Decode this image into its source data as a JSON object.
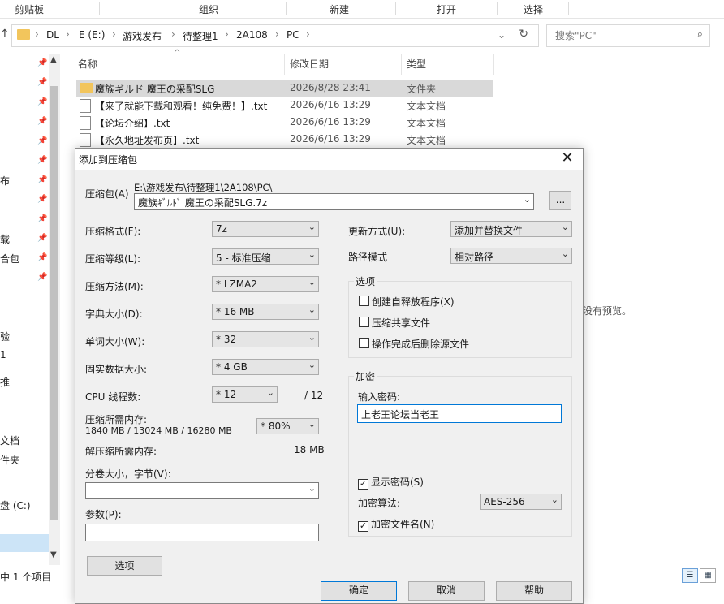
{
  "ribbon": {
    "groups": [
      "剪贴板",
      "组织",
      "新建",
      "打开",
      "选择"
    ]
  },
  "address_bar": {
    "crumbs": [
      "DL",
      "E (E:)",
      "游戏发布",
      "待整理1",
      "2A108",
      "PC"
    ]
  },
  "search": {
    "placeholder": "搜索\"PC\""
  },
  "left_pane": {
    "partial_labels": [
      "布",
      "载",
      "合包",
      "验",
      "1",
      "推",
      "文档",
      "件夹",
      "盘 (C:)"
    ]
  },
  "file_list": {
    "headers": {
      "name": "名称",
      "date": "修改日期",
      "type": "类型"
    },
    "rows": [
      {
        "name": "魔族ギルド 魔王の采配SLG",
        "date": "2026/8/28 23:41",
        "type": "文件夹",
        "icon": "folder-icon"
      },
      {
        "name": "【来了就能下载和观看！纯免费！】.txt",
        "date": "2026/6/16 13:29",
        "type": "文本文档",
        "icon": "text-file-icon"
      },
      {
        "name": "【论坛介绍】.txt",
        "date": "2026/6/16 13:29",
        "type": "文本文档",
        "icon": "text-file-icon"
      },
      {
        "name": "【永久地址发布页】.txt",
        "date": "2026/6/16 13:29",
        "type": "文本文档",
        "icon": "text-file-icon"
      }
    ]
  },
  "preview": {
    "text": "没有预览。"
  },
  "status": {
    "text": "中 1 个项目"
  },
  "dialog": {
    "title": "添加到压缩包",
    "archive_label": "压缩包(A)",
    "archive_path": "E:\\游戏发布\\待整理1\\2A108\\PC\\",
    "archive_name": "魔族ｷﾞﾙﾄﾞ 魔王の采配SLG.7z",
    "browse_label": "...",
    "format": {
      "label": "压缩格式(F):",
      "value": "7z"
    },
    "level": {
      "label": "压缩等级(L):",
      "value": "5 - 标准压缩"
    },
    "method": {
      "label": "压缩方法(M):",
      "value": "* LZMA2"
    },
    "dict": {
      "label": "字典大小(D):",
      "value": "* 16 MB"
    },
    "word": {
      "label": "单词大小(W):",
      "value": "* 32"
    },
    "solid": {
      "label": "固实数据大小:",
      "value": "* 4 GB"
    },
    "threads": {
      "label": "CPU 线程数:",
      "value": "* 12",
      "max": "/ 12"
    },
    "mem_compress": {
      "label": "压缩所需内存:",
      "detail": "1840 MB / 13024 MB / 16280 MB",
      "percent": "* 80%"
    },
    "mem_decompress": {
      "label": "解压缩所需内存:",
      "value": "18 MB"
    },
    "split": {
      "label": "分卷大小，字节(V):",
      "value": ""
    },
    "params": {
      "label": "参数(P):",
      "value": ""
    },
    "options_button": "选项",
    "update": {
      "label": "更新方式(U):",
      "value": "添加并替换文件"
    },
    "path_mode": {
      "label": "路径模式",
      "value": "相对路径"
    },
    "options_group": {
      "title": "选项",
      "items": [
        {
          "label": "创建自释放程序(X)",
          "checked": false
        },
        {
          "label": "压缩共享文件",
          "checked": false
        },
        {
          "label": "操作完成后删除源文件",
          "checked": false
        }
      ]
    },
    "encryption": {
      "title": "加密",
      "password_label": "输入密码:",
      "password_value": "上老王论坛当老王",
      "show_password": {
        "label": "显示密码(S)",
        "checked": true
      },
      "method_label": "加密算法:",
      "method_value": "AES-256",
      "encrypt_names": {
        "label": "加密文件名(N)",
        "checked": true
      }
    },
    "buttons": {
      "ok": "确定",
      "cancel": "取消",
      "help": "帮助"
    }
  }
}
